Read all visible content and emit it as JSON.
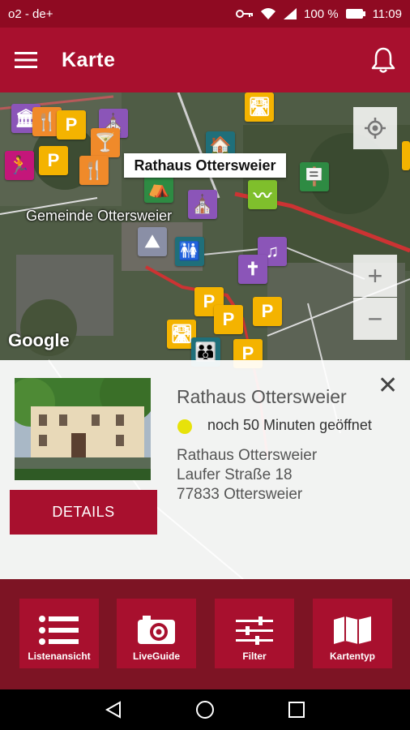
{
  "status": {
    "carrier": "o2 - de+",
    "battery": "100 %",
    "time": "11:09"
  },
  "header": {
    "title": "Karte",
    "menu_icon": "hamburger-menu-icon",
    "notification_icon": "bell-icon"
  },
  "map": {
    "area_label": "Gemeinde Ottersweier",
    "selected_marker_label": "Rathaus Ottersweier",
    "attribution": "Google",
    "zoom_in_label": "+",
    "zoom_out_label": "−",
    "pins": [
      {
        "icon": "P",
        "color": "yellow"
      },
      {
        "icon": "P",
        "color": "yellow"
      },
      {
        "icon": "P",
        "color": "yellow"
      },
      {
        "icon": "P",
        "color": "yellow"
      },
      {
        "icon": "P",
        "color": "yellow"
      },
      {
        "icon": "P",
        "color": "yellow"
      }
    ]
  },
  "poi_card": {
    "name": "Rathaus Ottersweier",
    "open_status": "noch 50 Minuten geöffnet",
    "status_color": "#e7e20a",
    "address_line1": "Rathaus Ottersweier",
    "address_line2": "Laufer Straße 18",
    "address_line3": "77833 Ottersweier",
    "details_label": "DETAILS",
    "close_label": "✕"
  },
  "toolbar": {
    "items": [
      {
        "label": "Listenansicht",
        "icon": "list-icon"
      },
      {
        "label": "LiveGuide",
        "icon": "camera-icon"
      },
      {
        "label": "Filter",
        "icon": "sliders-icon"
      },
      {
        "label": "Kartentyp",
        "icon": "map-icon"
      }
    ]
  },
  "colors": {
    "brand": "#a8102e",
    "brand_dark": "#8f0a22"
  }
}
